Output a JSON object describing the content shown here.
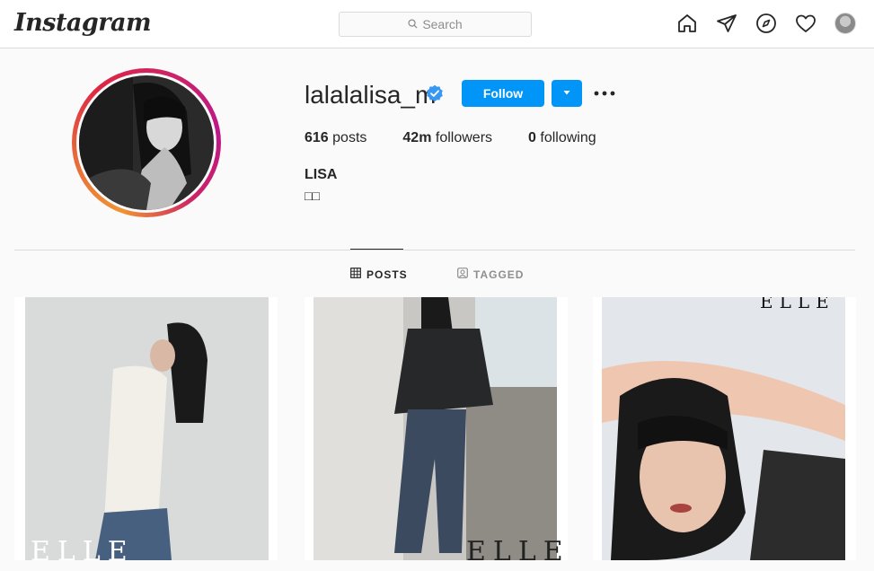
{
  "nav": {
    "logo": "Instagram",
    "search_placeholder": "Search",
    "icons": [
      "home-icon",
      "direct-icon",
      "explore-icon",
      "activity-icon",
      "profile-avatar"
    ]
  },
  "profile": {
    "username": "lalalalisa_m",
    "verified": true,
    "follow_label": "Follow",
    "stats": {
      "posts_count": "616",
      "posts_label": "posts",
      "followers_count": "42m",
      "followers_label": "followers",
      "following_count": "0",
      "following_label": "following"
    },
    "bio_name": "LISA",
    "bio_line": "□□"
  },
  "tabs": [
    {
      "label": "POSTS",
      "active": true
    },
    {
      "label": "TAGGED",
      "active": false
    }
  ],
  "posts": [
    {
      "watermark": "ELLE"
    },
    {
      "watermark": "ELLE"
    },
    {
      "watermark": "ELLE"
    }
  ],
  "colors": {
    "accent": "#0095f6",
    "border": "#dbdbdb",
    "text": "#262626",
    "muted": "#8e8e8e"
  }
}
